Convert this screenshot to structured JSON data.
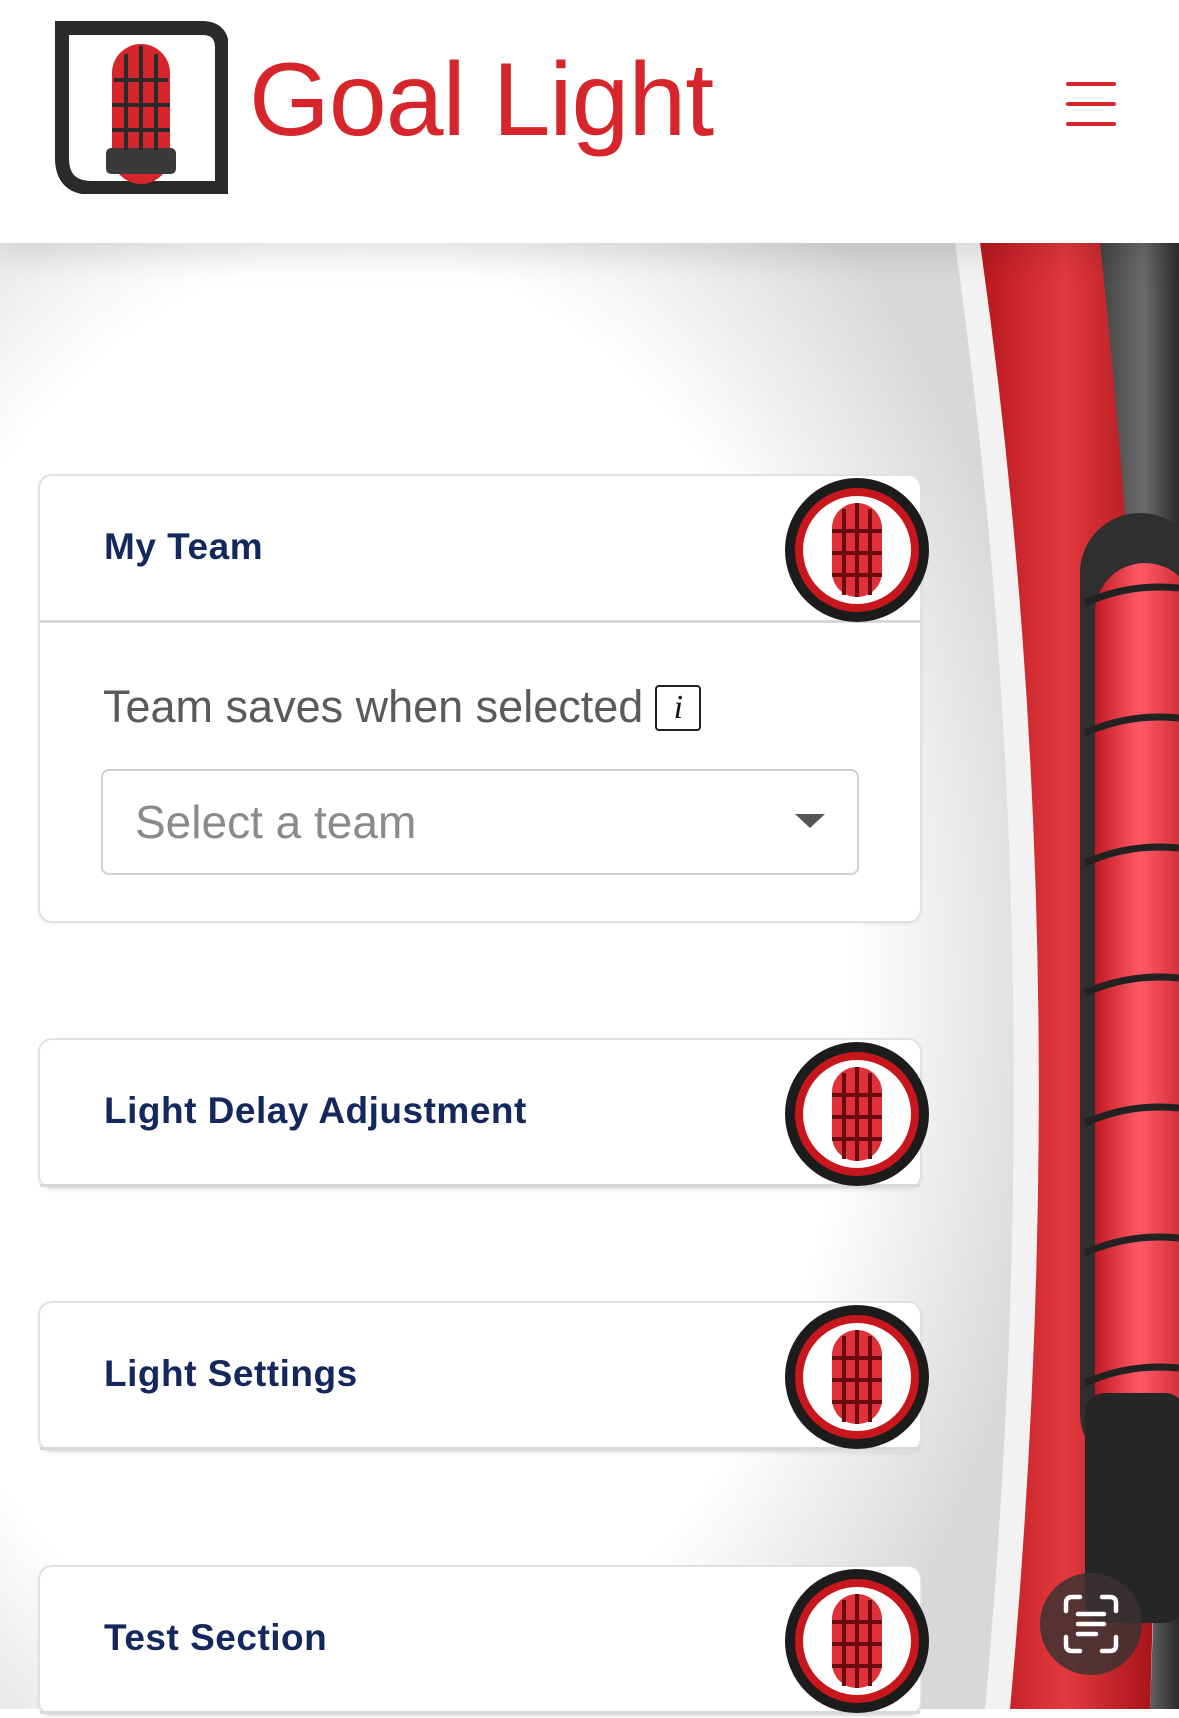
{
  "header": {
    "brand_name": "Goal Light",
    "logo_icon": "goal-light-logo",
    "menu_icon": "hamburger-menu-icon",
    "brand_color": "#d6262b"
  },
  "sections": [
    {
      "title": "My Team",
      "expanded": true,
      "icon": "goal-light-icon",
      "field_label": "Team saves when selected",
      "info_icon_glyph": "i",
      "select_placeholder": "Select a team"
    },
    {
      "title": "Light Delay Adjustment",
      "expanded": false,
      "icon": "goal-light-icon"
    },
    {
      "title": "Light Settings",
      "expanded": false,
      "icon": "goal-light-icon"
    },
    {
      "title": "Test Section",
      "expanded": false,
      "icon": "goal-light-icon"
    }
  ],
  "floating_button": {
    "icon": "text-scan-icon"
  },
  "colors": {
    "title_text": "#14285e",
    "accent_red": "#d6262b",
    "label_text": "#5a5a5a"
  }
}
